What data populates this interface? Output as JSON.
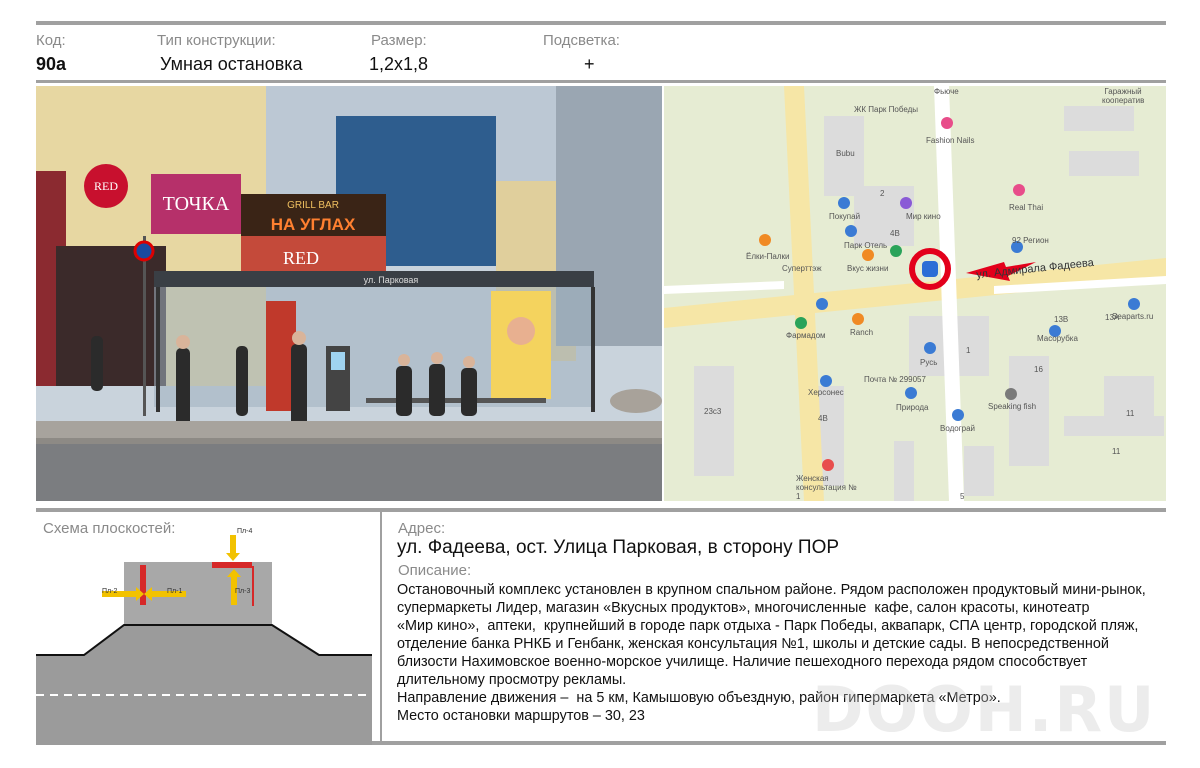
{
  "header": {
    "code_label": "Код:",
    "code_value": "90а",
    "type_label": "Тип конструкции:",
    "type_value": "Умная остановка",
    "size_label": "Размер:",
    "size_value": "1,2х1,8",
    "light_label": "Подсветка:",
    "light_value": "+"
  },
  "photo": {
    "signs": {
      "red_logo": "RED",
      "tochka": "ТОЧКА",
      "grill": "GRILL BAR",
      "na_uglah": "НА УГЛАХ",
      "red_bar": "RED",
      "stop_name": "ул. Парковая"
    }
  },
  "map": {
    "street": "ул. Адмирала Фадеева",
    "labels": [
      {
        "text": "Фьюче"
      },
      {
        "text": "Гаражный кооператив"
      },
      {
        "text": "ЖК Парк Победы"
      },
      {
        "text": "Fashion Nails"
      },
      {
        "text": "Bubu"
      },
      {
        "text": "Real Thai"
      },
      {
        "text": "Покупай"
      },
      {
        "text": "Мир кино"
      },
      {
        "text": "Парк Отель"
      },
      {
        "text": "92 Регион"
      },
      {
        "text": "Ёлки-Палки"
      },
      {
        "text": "Вкус жизни"
      },
      {
        "text": "Суперттэж"
      },
      {
        "text": "Фармадом"
      },
      {
        "text": "Ranch"
      },
      {
        "text": "Масорубка"
      },
      {
        "text": "Seaparts.ru"
      },
      {
        "text": "Русь"
      },
      {
        "text": "Херсонес"
      },
      {
        "text": "Почта № 299057"
      },
      {
        "text": "Природа"
      },
      {
        "text": "Speaking fish"
      },
      {
        "text": "Водограй"
      },
      {
        "text": "Женская консультация № 1"
      }
    ],
    "house_numbers": [
      "2",
      "4В",
      "1",
      "13В",
      "13А",
      "16",
      "4В",
      "23с3",
      "11",
      "11",
      "5"
    ]
  },
  "schema": {
    "title": "Схема плоскостей:",
    "planes": [
      "Пл-1",
      "Пл-2",
      "Пл-3",
      "Пл-4"
    ]
  },
  "address": {
    "label": "Адрес:",
    "value": "ул. Фадеева, ост. Улица Парковая, в сторону ПОР"
  },
  "description": {
    "label": "Описание:",
    "text": "Остановочный комплекс установлен в крупном спальном районе. Рядом расположен продуктовый мини-рынок,\nсупермаркеты Лидер, магазин «Вкусных продуктов», многочисленные  кафе, салон красоты, кинотеатр\n«Мир кино»,  аптеки,  крупнейший в городе парк отдыха - Парк Победы, аквапарк, СПА центр, городской пляж,\nотделение банка РНКБ и Генбанк, женская консультация №1, школы и детские сады. В непосредственной\nблизости Нахимовское военно-морское училище. Наличие пешеходного перехода рядом способствует\nдлительному просмотру рекламы.\nНаправление движения –  на 5 км, Камышовую объездную, район гипермаркета «Метро».\nМесто остановки маршрутов – 30, 23"
  },
  "watermark": "DOOH.RU",
  "colors": {
    "rule": "#a0a0a0",
    "label_gray": "#8a8a8a",
    "plane_red": "#d62828",
    "arrow_yellow": "#f2c200",
    "map_bg": "#e6ecd3",
    "marker_red": "#e3001b"
  }
}
